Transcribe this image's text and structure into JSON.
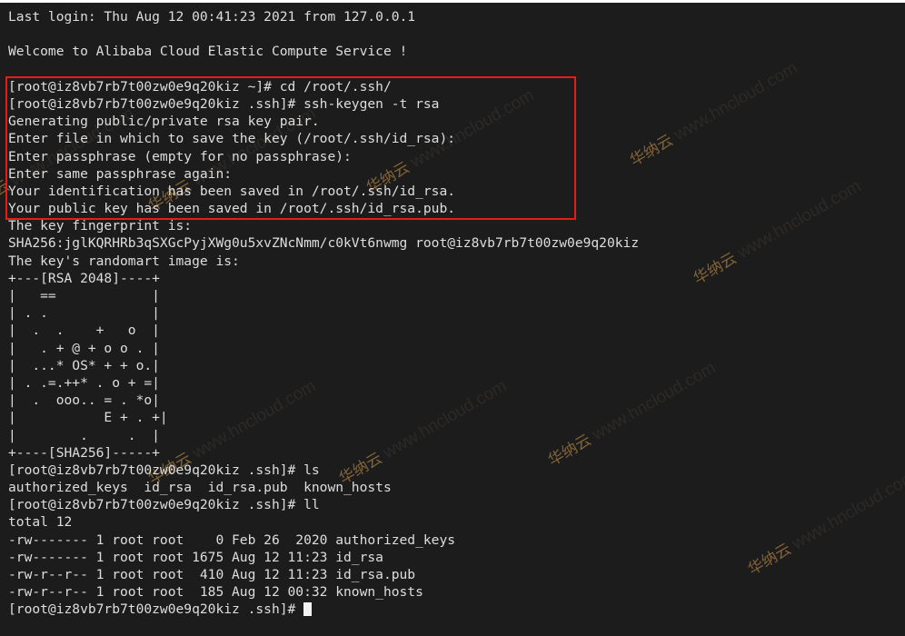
{
  "terminal": {
    "background_color": "#1c1c1c",
    "text_color": "#dedede",
    "annotation_color": "#e81b1b",
    "cursor_color": "#f2f2f2",
    "lines": [
      "Last login: Thu Aug 12 00:41:23 2021 from 127.0.0.1",
      "",
      "Welcome to Alibaba Cloud Elastic Compute Service !",
      "",
      "[root@iz8vb7rb7t00zw0e9q20kiz ~]# cd /root/.ssh/",
      "[root@iz8vb7rb7t00zw0e9q20kiz .ssh]# ssh-keygen -t rsa",
      "Generating public/private rsa key pair.",
      "Enter file in which to save the key (/root/.ssh/id_rsa): ",
      "Enter passphrase (empty for no passphrase): ",
      "Enter same passphrase again: ",
      "Your identification has been saved in /root/.ssh/id_rsa.",
      "Your public key has been saved in /root/.ssh/id_rsa.pub.",
      "The key fingerprint is:",
      "SHA256:jglKQRHRb3qSXGcPyjXWg0u5xvZNcNmm/c0kVt6nwmg root@iz8vb7rb7t00zw0e9q20kiz",
      "The key's randomart image is:",
      "+---[RSA 2048]----+",
      "|   ==            |",
      "| . .             |",
      "|  .  .    +   o  |",
      "|   . + @ + o o . |",
      "|  ...* OS* + + o.|",
      "| . .=.++* . o + =|",
      "|  .  ooo.. = . *o|",
      "|           E + . +|",
      "|        .     .  |",
      "+----[SHA256]-----+",
      "[root@iz8vb7rb7t00zw0e9q20kiz .ssh]# ls",
      "authorized_keys  id_rsa  id_rsa.pub  known_hosts",
      "[root@iz8vb7rb7t00zw0e9q20kiz .ssh]# ll",
      "total 12",
      "-rw------- 1 root root    0 Feb 26  2020 authorized_keys",
      "-rw------- 1 root root 1675 Aug 12 11:23 id_rsa",
      "-rw-r--r-- 1 root root  410 Aug 12 11:23 id_rsa.pub",
      "-rw-r--r-- 1 root root  185 Aug 12 00:32 known_hosts"
    ],
    "final_prompt": "[root@iz8vb7rb7t00zw0e9q20kiz .ssh]# ",
    "hostname": "iz8vb7rb7t00zw0e9q20kiz",
    "user": "root",
    "cwd": ".ssh",
    "key_fingerprint": "SHA256:jglKQRHRb3qSXGcPyjXWg0u5xvZNcNmm/c0kVt6nwmg",
    "key_type": "RSA 2048",
    "file_listing": {
      "total": "total 12",
      "rows": [
        {
          "perms": "-rw-------",
          "links": "1",
          "owner": "root",
          "group": "root",
          "size": "0",
          "month": "Feb",
          "day": "26",
          "time": "2020",
          "name": "authorized_keys"
        },
        {
          "perms": "-rw-------",
          "links": "1",
          "owner": "root",
          "group": "root",
          "size": "1675",
          "month": "Aug",
          "day": "12",
          "time": "11:23",
          "name": "id_rsa"
        },
        {
          "perms": "-rw-r--r--",
          "links": "1",
          "owner": "root",
          "group": "root",
          "size": "410",
          "month": "Aug",
          "day": "12",
          "time": "11:23",
          "name": "id_rsa.pub"
        },
        {
          "perms": "-rw-r--r--",
          "links": "1",
          "owner": "root",
          "group": "root",
          "size": "185",
          "month": "Aug",
          "day": "12",
          "time": "00:32",
          "name": "known_hosts"
        }
      ]
    },
    "ls_output": "authorized_keys  id_rsa  id_rsa.pub  known_hosts"
  },
  "watermarks": {
    "text": "www.hncloud.com",
    "brand_cn": "华纳云",
    "items": [
      {
        "text": "www.hncloud.com",
        "cn": "华纳云"
      },
      {
        "text": "www.hncloud.com",
        "cn": "华纳云"
      },
      {
        "text": "www.hncloud.com",
        "cn": "华纳云"
      },
      {
        "text": "www.hncloud.com",
        "cn": "华纳云"
      },
      {
        "text": "www.hncloud.com",
        "cn": "华纳云"
      },
      {
        "text": "www.hncloud.com",
        "cn": "华纳云"
      },
      {
        "text": "www.hncloud.com",
        "cn": "华纳云"
      },
      {
        "text": "www.hncloud.com",
        "cn": "华纳云"
      },
      {
        "text": "www.hncloud.com",
        "cn": "华纳云"
      }
    ]
  }
}
